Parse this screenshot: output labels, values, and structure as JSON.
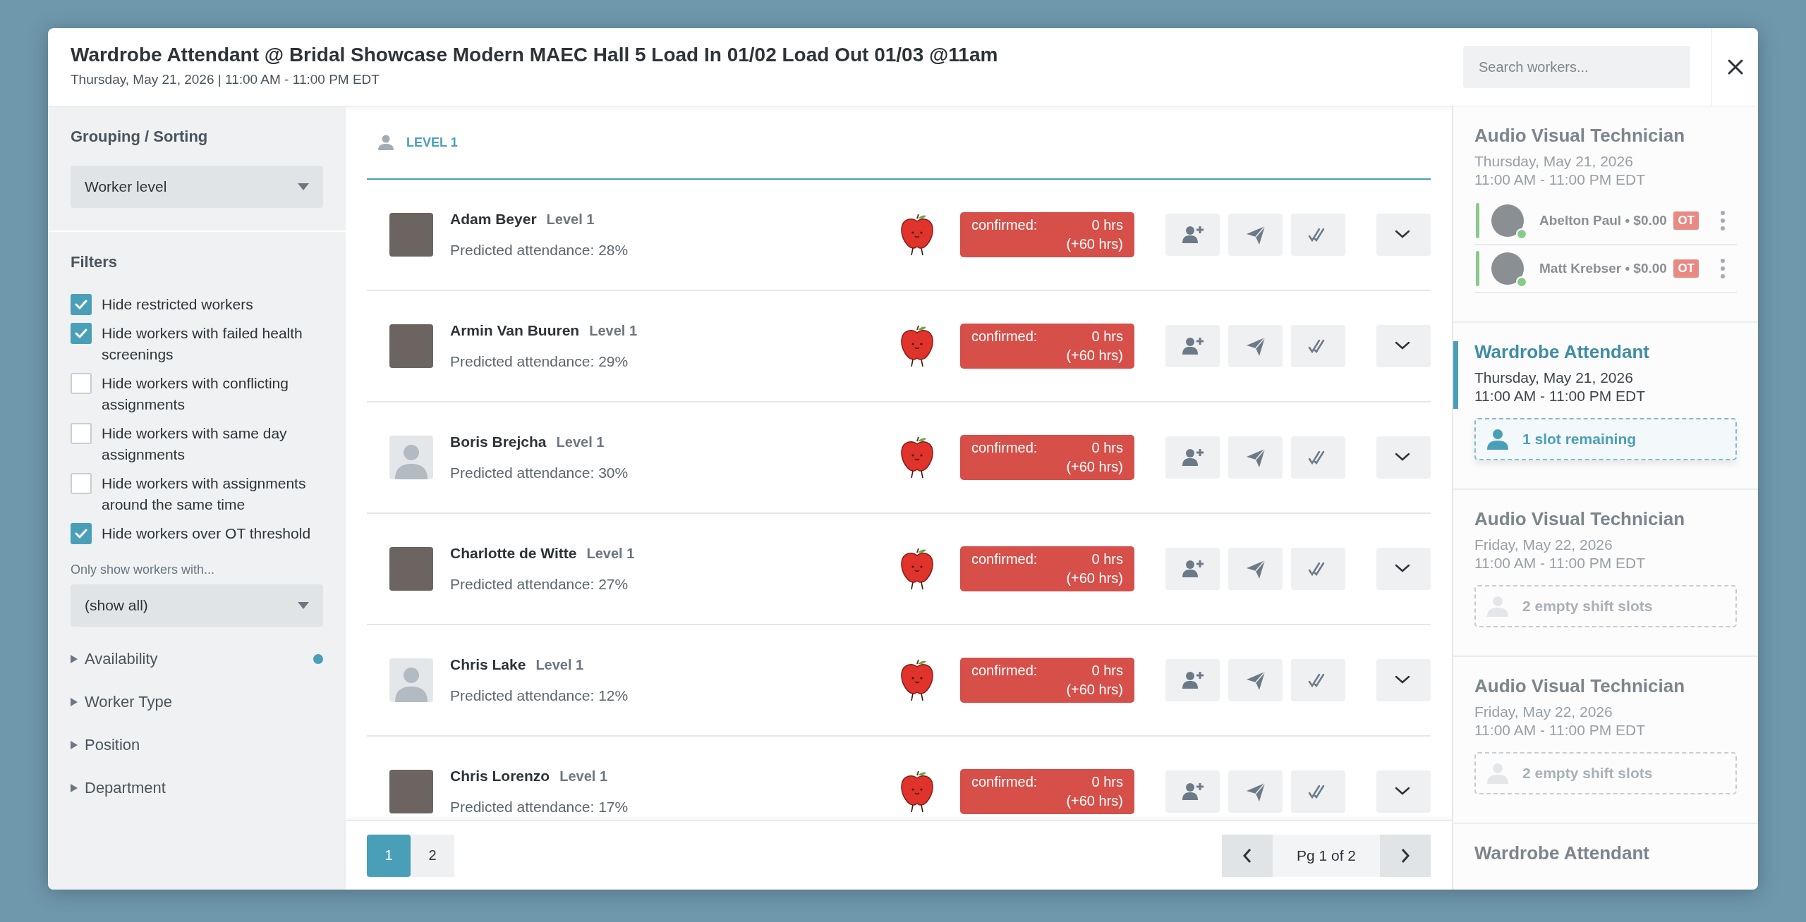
{
  "header": {
    "title": "Wardrobe Attendant @ Bridal Showcase Modern MAEC Hall 5 Load In 01/02 Load Out 01/03 @11am",
    "subtitle": "Thursday, May 21, 2026 | 11:00 AM - 11:00 PM EDT"
  },
  "search": {
    "placeholder": "Search workers..."
  },
  "sidebar": {
    "grouping_title": "Grouping / Sorting",
    "grouping_select": "Worker level",
    "filters_title": "Filters",
    "filters": [
      {
        "label": "Hide restricted workers",
        "checked": true
      },
      {
        "label": "Hide workers with failed health screenings",
        "checked": true
      },
      {
        "label": "Hide workers with conflicting assignments",
        "checked": false
      },
      {
        "label": "Hide workers with same day assignments",
        "checked": false
      },
      {
        "label": "Hide workers with assignments around the same time",
        "checked": false
      },
      {
        "label": "Hide workers over OT threshold",
        "checked": true
      }
    ],
    "only_show_label": "Only show workers with...",
    "only_show_select": "(show all)",
    "sections": [
      {
        "label": "Availability",
        "indicator": true
      },
      {
        "label": "Worker Type",
        "indicator": false
      },
      {
        "label": "Position",
        "indicator": false
      },
      {
        "label": "Department",
        "indicator": false
      }
    ]
  },
  "group": {
    "label": "LEVEL 1"
  },
  "workers": [
    {
      "name": "Adam Beyer",
      "level": "Level 1",
      "attendance": "Predicted attendance: 28%",
      "kind": "photo",
      "status": "confirmed:",
      "hours": "0 hrs",
      "extra": "(+60 hrs)"
    },
    {
      "name": "Armin Van Buuren",
      "level": "Level 1",
      "attendance": "Predicted attendance: 29%",
      "kind": "photo",
      "status": "confirmed:",
      "hours": "0 hrs",
      "extra": "(+60 hrs)"
    },
    {
      "name": "Boris Brejcha",
      "level": "Level 1",
      "attendance": "Predicted attendance: 30%",
      "kind": "placeholder",
      "status": "confirmed:",
      "hours": "0 hrs",
      "extra": "(+60 hrs)"
    },
    {
      "name": "Charlotte de Witte",
      "level": "Level 1",
      "attendance": "Predicted attendance: 27%",
      "kind": "photo",
      "status": "confirmed:",
      "hours": "0 hrs",
      "extra": "(+60 hrs)"
    },
    {
      "name": "Chris Lake",
      "level": "Level 1",
      "attendance": "Predicted attendance: 12%",
      "kind": "placeholder",
      "status": "confirmed:",
      "hours": "0 hrs",
      "extra": "(+60 hrs)"
    },
    {
      "name": "Chris Lorenzo",
      "level": "Level 1",
      "attendance": "Predicted attendance: 17%",
      "kind": "photo",
      "status": "confirmed:",
      "hours": "0 hrs",
      "extra": "(+60 hrs)"
    }
  ],
  "pagination": {
    "pages": [
      {
        "label": "1",
        "selected": true
      },
      {
        "label": "2",
        "selected": false
      }
    ],
    "page_label": "Pg 1 of 2"
  },
  "shifts": [
    {
      "title": "Audio Visual Technician",
      "date": "Thursday, May 21, 2026",
      "time": "11:00 AM - 11:00 PM EDT",
      "selected": false,
      "assignees": [
        {
          "name": "Abelton Paul • $0.00",
          "online": true,
          "badge": "OT"
        },
        {
          "name": "Matt Krebser • $0.00",
          "online": true,
          "badge": "OT"
        }
      ]
    },
    {
      "title": "Wardrobe Attendant",
      "date": "Thursday, May 21, 2026",
      "time": "11:00 AM - 11:00 PM EDT",
      "selected": true,
      "slot": {
        "kind": "remaining",
        "label": "1 slot remaining"
      }
    },
    {
      "title": "Audio Visual Technician",
      "date": "Friday, May 22, 2026",
      "time": "11:00 AM - 11:00 PM EDT",
      "selected": false,
      "slot": {
        "kind": "empty",
        "label": "2 empty shift slots"
      }
    },
    {
      "title": "Audio Visual Technician",
      "date": "Friday, May 22, 2026",
      "time": "11:00 AM - 11:00 PM EDT",
      "selected": false,
      "slot": {
        "kind": "empty",
        "label": "2 empty shift slots"
      }
    },
    {
      "title": "Wardrobe Attendant",
      "selected": false
    }
  ]
}
